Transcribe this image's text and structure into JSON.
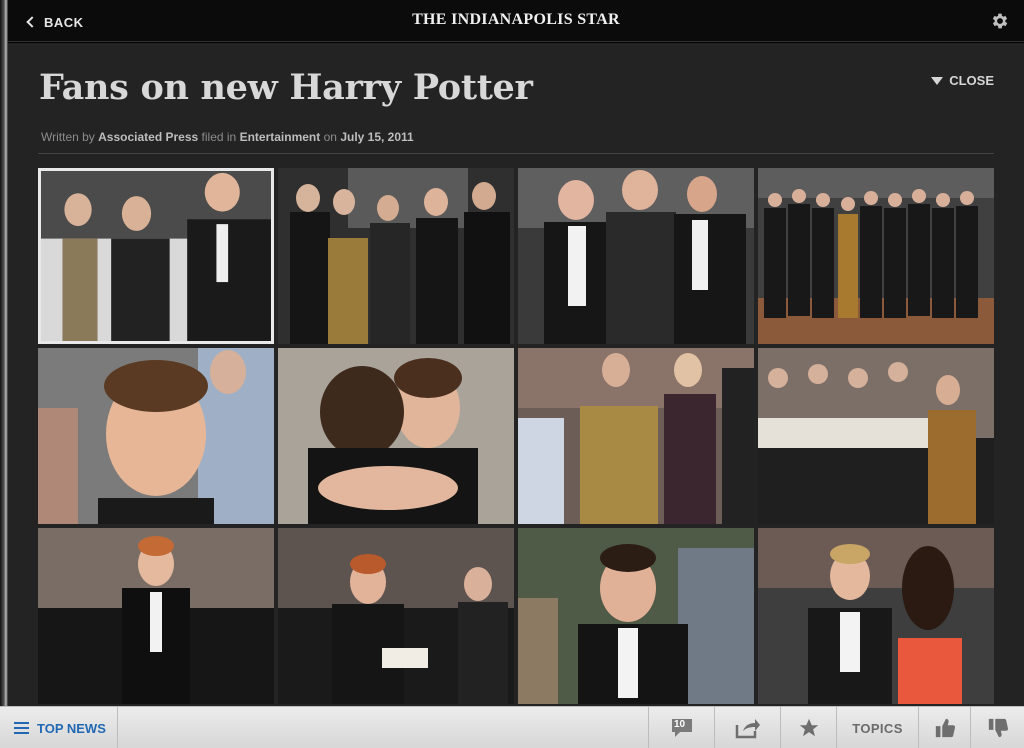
{
  "app": {
    "brand": "The Indianapolis Star",
    "back_label": "BACK"
  },
  "article": {
    "title": "Fans on new Harry Potter",
    "close_label": "CLOSE",
    "byline": {
      "prefix": "Written by",
      "author": "Associated Press",
      "filed": "filed in",
      "section": "Entertainment",
      "on": "on",
      "date": "July 15, 2011"
    }
  },
  "gallery": {
    "selected_index": 0,
    "photos": [
      {
        "subject": "three-stars-red-carpet"
      },
      {
        "subject": "cast-group-posters"
      },
      {
        "subject": "three-men-suits"
      },
      {
        "subject": "large-cast-group"
      },
      {
        "subject": "closeup-smiling-man"
      },
      {
        "subject": "hug"
      },
      {
        "subject": "gold-dress-crowd"
      },
      {
        "subject": "signing-fans"
      },
      {
        "subject": "red-hair-black-suit"
      },
      {
        "subject": "signing-autographs"
      },
      {
        "subject": "dark-hair-man-suit"
      },
      {
        "subject": "couple-red-dress"
      }
    ]
  },
  "bottom_bar": {
    "top_news_label": "TOP NEWS",
    "comments_count": "10",
    "topics_label": "TOPICS"
  },
  "colors": {
    "accent_blue": "#2168b3",
    "article_bg": "#232323",
    "title_text": "#d8d8d8"
  }
}
